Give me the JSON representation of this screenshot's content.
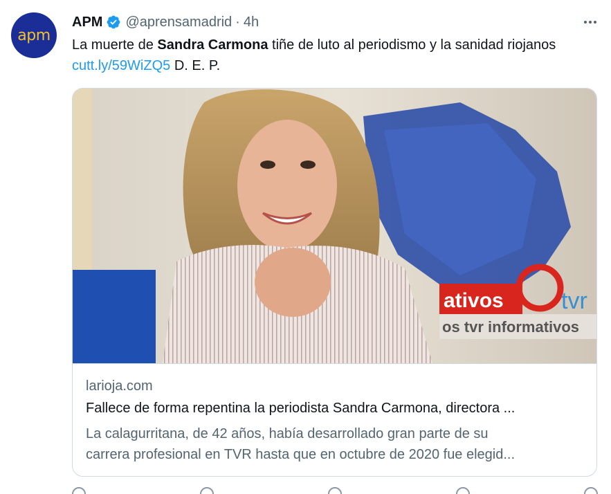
{
  "tweet": {
    "avatar_text": "apm",
    "display_name": "APM",
    "handle": "@aprensamadrid",
    "separator": "·",
    "time": "4h",
    "text_part1": "La muerte de ",
    "text_bold": "Sandra Carmona",
    "text_part2": " tiñe de luto al periodismo y la sanidad riojanos ",
    "link": "cutt.ly/59WiZQ5",
    "text_part3": " D. E. P."
  },
  "card": {
    "domain": "larioja.com",
    "title": "Fallece de forma repentina la periodista Sandra Carmona, directora ...",
    "desc_line1": "La calagurritana, de 42 años, había desarrollado gran parte de su",
    "desc_line2": "carrera profesional en TVR hasta que en octubre de 2020 fue elegid...",
    "image_sign_text": "ativos",
    "image_logo_text": "tvr",
    "image_banner_text": "os tvr informativos"
  },
  "colors": {
    "accent": "#1d9bf0",
    "avatar_bg": "#1b2d96",
    "avatar_text": "#f3c12c",
    "muted": "#536471",
    "sign_red": "#d8261e"
  },
  "icons": [
    "verified-badge-icon",
    "more-options-icon"
  ]
}
